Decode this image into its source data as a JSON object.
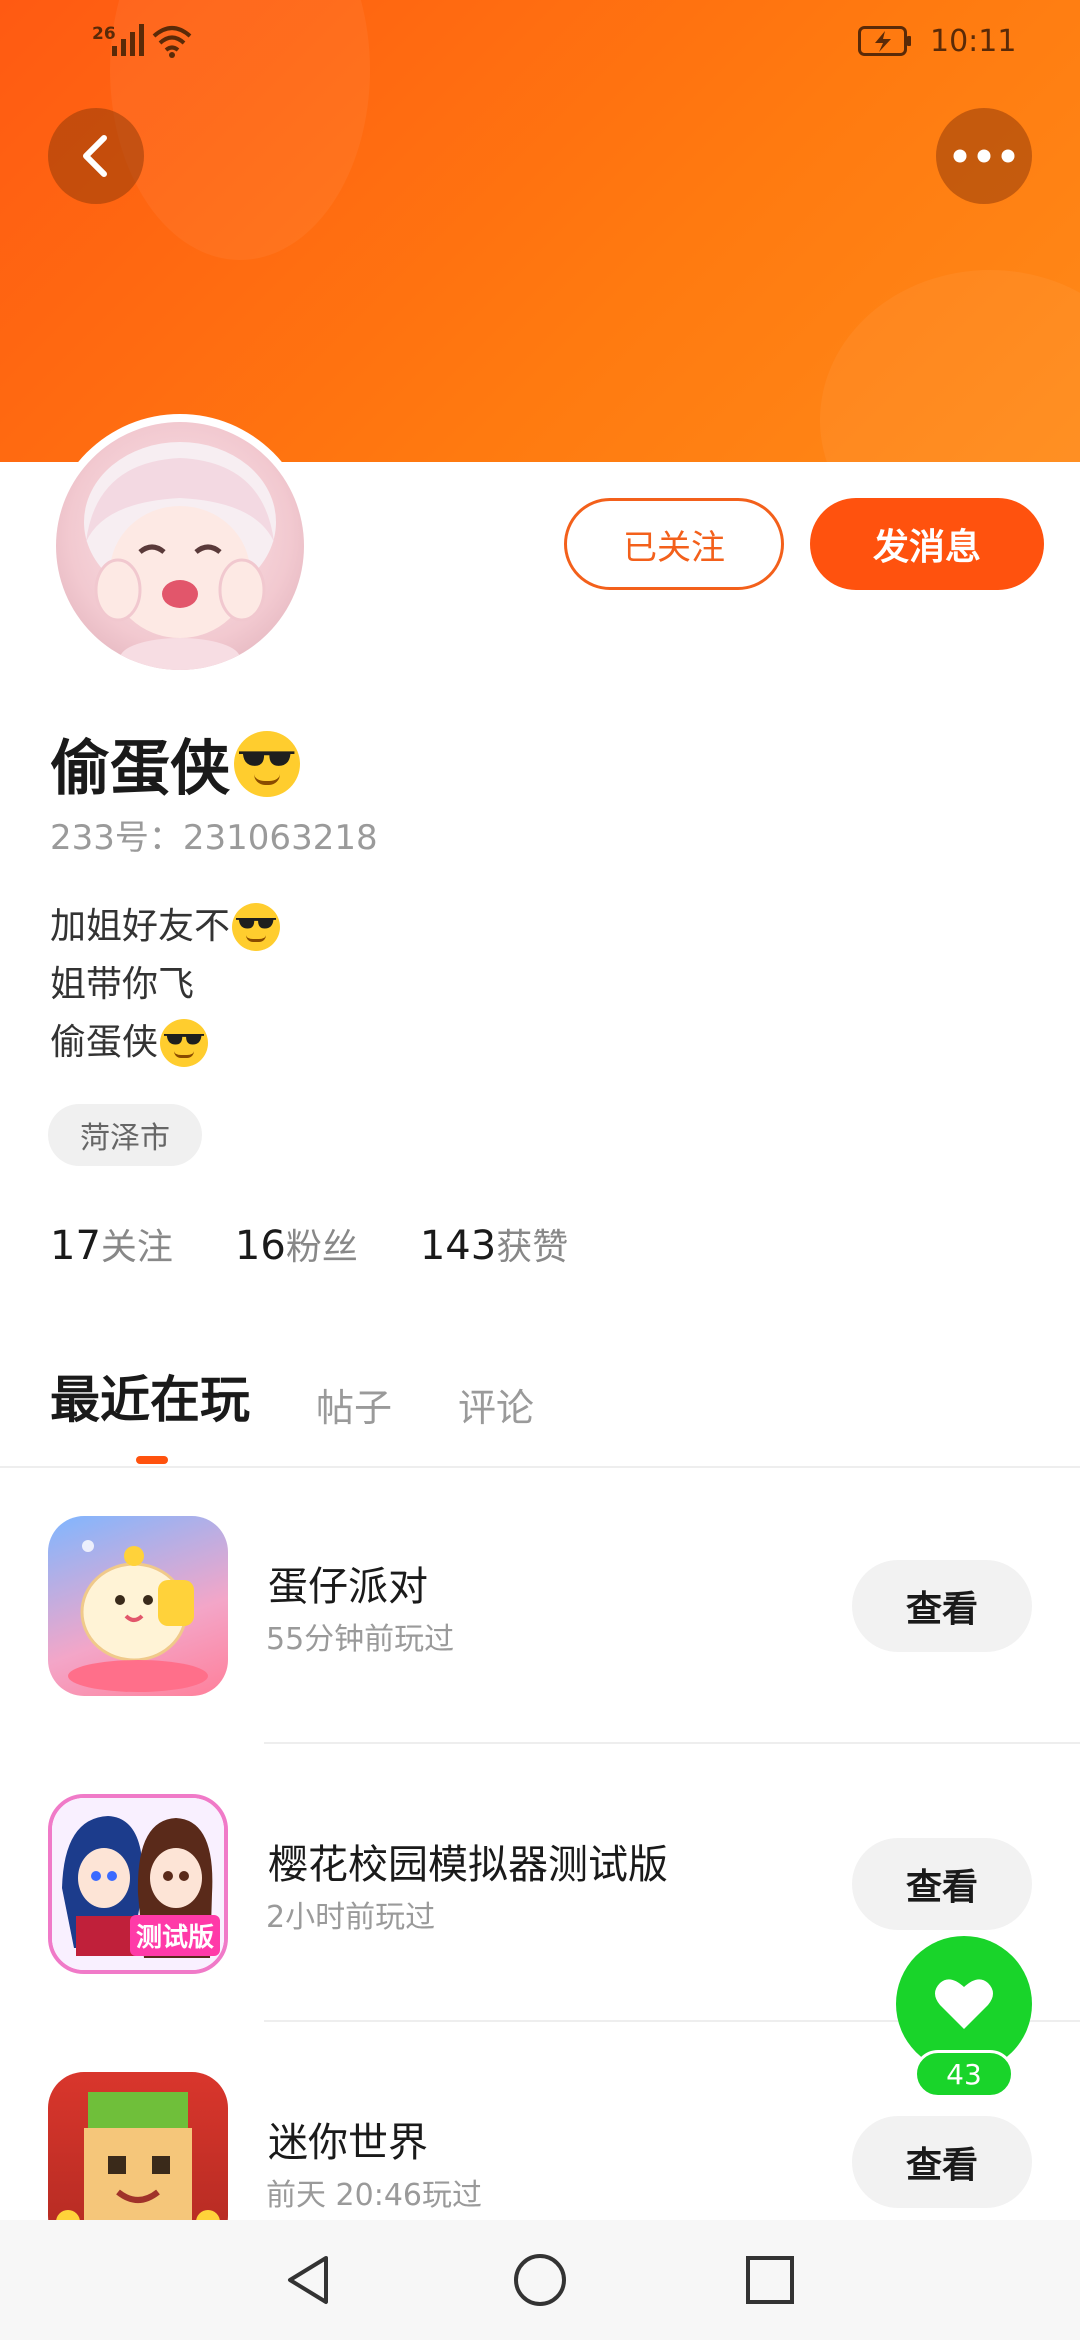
{
  "status_bar": {
    "network_label": "26",
    "time": "10:11"
  },
  "header": {
    "back_icon": "chevron-left-icon",
    "more_icon": "more-horizontal-icon"
  },
  "profile": {
    "follow_button": "已关注",
    "message_button": "发消息",
    "username": "偷蛋侠",
    "uid_label": "233号：",
    "uid_value": "231063218",
    "bio_lines": [
      "加姐好友不",
      "姐带你飞",
      "偷蛋侠"
    ],
    "location": "菏泽市",
    "stats": [
      {
        "value": "17",
        "label": "关注"
      },
      {
        "value": "16",
        "label": "粉丝"
      },
      {
        "value": "143",
        "label": "获赞"
      }
    ]
  },
  "tabs": [
    {
      "label": "最近在玩",
      "active": true
    },
    {
      "label": "帖子",
      "active": false
    },
    {
      "label": "评论",
      "active": false
    }
  ],
  "games": [
    {
      "name": "蛋仔派对",
      "time": "55分钟前玩过",
      "button": "查看"
    },
    {
      "name": "樱花校园模拟器测试版",
      "time": "2小时前玩过",
      "button": "查看",
      "icon_badge": "测试版"
    },
    {
      "name": "迷你世界",
      "time": "前天 20:46玩过",
      "button": "查看"
    }
  ],
  "like": {
    "count": "43",
    "icon": "heart-icon"
  },
  "colors": {
    "accent": "#ff520e",
    "like_green": "#19d42a"
  }
}
